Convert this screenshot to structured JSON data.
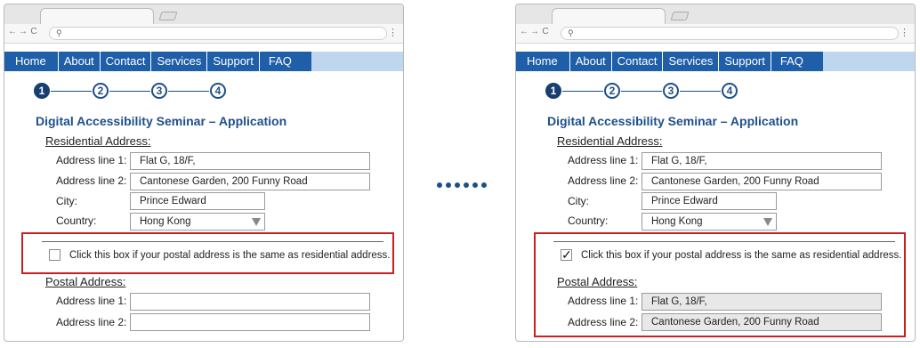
{
  "nav": [
    "Home",
    "About",
    "Contact",
    "Services",
    "Support",
    "FAQ"
  ],
  "steps": [
    "❶",
    "②",
    "③",
    "④"
  ],
  "form": {
    "title": "Digital Accessibility Seminar – Application",
    "residential_label": "Residential Address:",
    "postal_label": "Postal Address:",
    "address1_label": "Address line 1:",
    "address2_label": "Address line 2:",
    "city_label": "City:",
    "country_label": "Country:",
    "address1_value": "Flat G, 18/F,",
    "address2_value": "Cantonese Garden, 200 Funny Road",
    "city_value": "Prince Edward",
    "country_value": "Hong Kong",
    "checkbox_text": "Click this box if your postal address is the same as residential address.",
    "check_mark": "✓"
  },
  "icons": {
    "back": "←",
    "forward": "→",
    "reload": "C",
    "search": "🔍",
    "menu": "⋮"
  },
  "colors": {
    "nav_bg": "#1f5ea8",
    "nav_strip": "#bfd7ee",
    "title": "#1e4f8c",
    "highlight": "#cc1f1f"
  }
}
